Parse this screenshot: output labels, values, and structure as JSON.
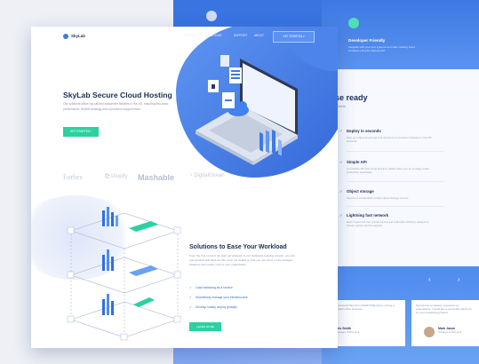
{
  "brand": {
    "logo_text": "SkyLab"
  },
  "nav": {
    "items": [
      "FEATURES",
      "SOLUTIONS",
      "SUPPORT",
      "ABOUT"
    ],
    "cta": "GET STARTED"
  },
  "hero": {
    "title": "SkyLab Secure Cloud Hosting",
    "description": "Our solutions utilize top-ranked datacenter facilities in the US, ensuring first-class performance, flexible strategy and a proactive support team.",
    "button": "GET STARTED"
  },
  "partner_logos": [
    "Forbes",
    "shopify",
    "Mashable",
    "DigitalOcean"
  ],
  "solutions": {
    "title": "Solutions to Ease Your Workload",
    "description": "From the first moment we start our analysis, to our dedicated ongoing support, you can rest assured with SkyLab. We cover the details so that you can focus on the strategic initiatives that matter most to your organization.",
    "items": [
      "Load balancing as a service",
      "Seamlessly manage your infrastructure",
      "Develop locally, deploy globally"
    ],
    "button": "LEARN MORE"
  },
  "back_page": {
    "dev_title": "Developer Friendly",
    "dev_desc": "Integrate with your own systems and start creating cloud solutions using the SkyLab API.",
    "enterprise_title": "rprise ready",
    "enterprise_sub": "rise environments",
    "features": [
      {
        "title": "Deploy in seconds",
        "desc": "Spin up a SkyLab and get root access to a computer instance in only 55 seconds."
      },
      {
        "title": "Simple API",
        "desc": "An intuitive API and command line utilities allow you to run large-scale production workloads."
      },
      {
        "title": "Object storage",
        "desc": "Spaces is a beautifully simple object storage service."
      },
      {
        "title": "Lightning fast network",
        "desc": "Each hypervisor has a dual-homed and redundant 40Gbps network to ensure uptime and throughput."
      }
    ],
    "testimonials": [
      {
        "text": "I'd recommend SkyLab to EVERYONE who's running a successful online business.",
        "name": "aris Smith",
        "role": "Manager at Microsoft"
      },
      {
        "text": "SkyLab has completely surpassed our expectations. I would like to personally thank you for your outstanding product.",
        "name": "Mark Jason",
        "role": "Manager at Microsoft"
      }
    ],
    "arrows": "‹ ›"
  },
  "colors": {
    "accent_blue": "#3b7be8",
    "accent_green": "#29d2a0",
    "heading": "#1d2d55"
  }
}
